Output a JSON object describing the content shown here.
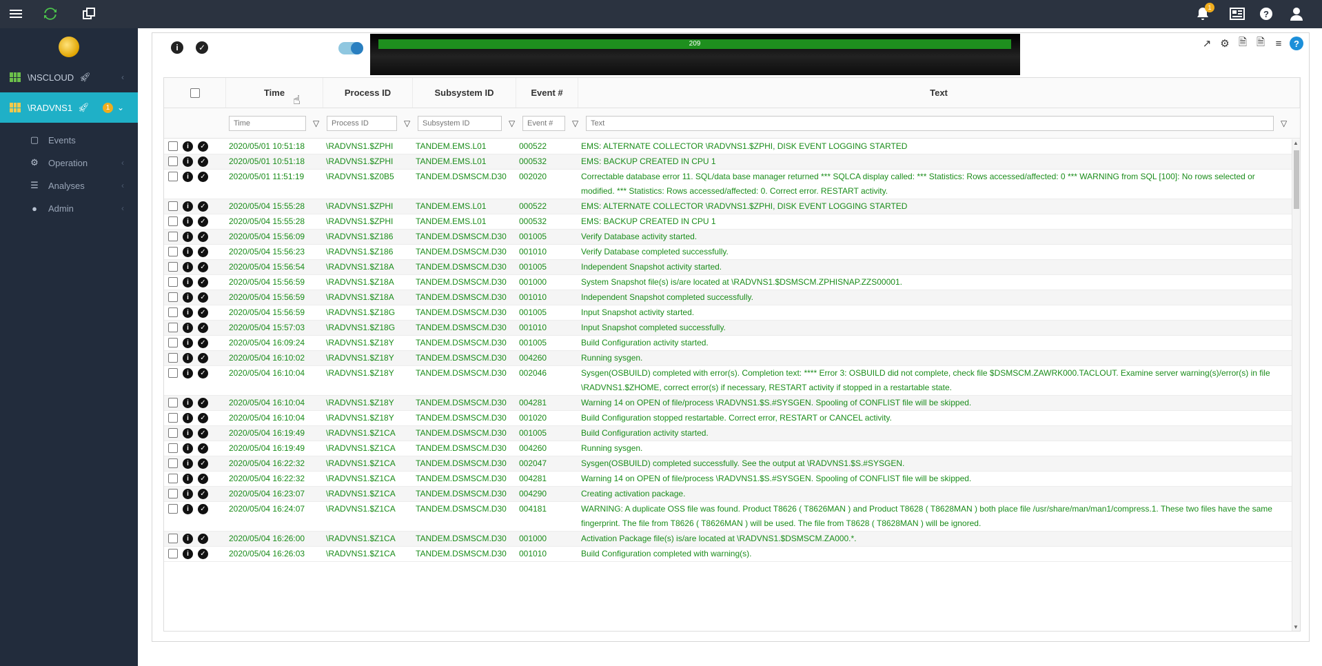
{
  "topbar": {
    "icons": [
      "menu-icon",
      "refresh-icon",
      "copy-window-icon",
      "bell-icon",
      "newspaper-icon",
      "help-icon",
      "user-icon"
    ],
    "notification_count": "1"
  },
  "sidebar": {
    "nodes": [
      {
        "label": "\\NSCLOUD",
        "badge": ""
      },
      {
        "label": "\\RADVNS1",
        "badge": "1"
      }
    ],
    "menu": [
      {
        "label": "Events",
        "icon": "chat-icon"
      },
      {
        "label": "Operation",
        "icon": "cogs-icon"
      },
      {
        "label": "Analyses",
        "icon": "document-icon"
      },
      {
        "label": "Admin",
        "icon": "user-icon"
      }
    ]
  },
  "panel": {
    "progress_value": "209",
    "toggle_on": true
  },
  "grid": {
    "columns": [
      "Time",
      "Process ID",
      "Subsystem ID",
      "Event #",
      "Text"
    ],
    "filter_placeholders": [
      "Time",
      "Process ID",
      "Subsystem ID",
      "Event #",
      "Text"
    ],
    "rows": [
      {
        "time": "2020/05/01 10:51:18",
        "process": "\\RADVNS1.$ZPHI",
        "subsystem": "TANDEM.EMS.L01",
        "event": "000522",
        "text": "EMS: ALTERNATE COLLECTOR \\RADVNS1.$ZPHI, DISK EVENT LOGGING STARTED"
      },
      {
        "time": "2020/05/01 10:51:18",
        "process": "\\RADVNS1.$ZPHI",
        "subsystem": "TANDEM.EMS.L01",
        "event": "000532",
        "text": "EMS: BACKUP CREATED IN CPU 1"
      },
      {
        "time": "2020/05/01 11:51:19",
        "process": "\\RADVNS1.$Z0B5",
        "subsystem": "TANDEM.DSMSCM.D30",
        "event": "002020",
        "text": "Correctable database error 11. SQL/data base manager returned *** SQLCA display called: *** Statistics: Rows accessed/affected: 0 *** WARNING from SQL [100]: No rows selected or modified. *** Statistics: Rows accessed/affected: 0. Correct error. RESTART activity."
      },
      {
        "time": "2020/05/04 15:55:28",
        "process": "\\RADVNS1.$ZPHI",
        "subsystem": "TANDEM.EMS.L01",
        "event": "000522",
        "text": "EMS: ALTERNATE COLLECTOR \\RADVNS1.$ZPHI, DISK EVENT LOGGING STARTED"
      },
      {
        "time": "2020/05/04 15:55:28",
        "process": "\\RADVNS1.$ZPHI",
        "subsystem": "TANDEM.EMS.L01",
        "event": "000532",
        "text": "EMS: BACKUP CREATED IN CPU 1"
      },
      {
        "time": "2020/05/04 15:56:09",
        "process": "\\RADVNS1.$Z186",
        "subsystem": "TANDEM.DSMSCM.D30",
        "event": "001005",
        "text": "Verify Database activity started."
      },
      {
        "time": "2020/05/04 15:56:23",
        "process": "\\RADVNS1.$Z186",
        "subsystem": "TANDEM.DSMSCM.D30",
        "event": "001010",
        "text": "Verify Database completed successfully."
      },
      {
        "time": "2020/05/04 15:56:54",
        "process": "\\RADVNS1.$Z18A",
        "subsystem": "TANDEM.DSMSCM.D30",
        "event": "001005",
        "text": "Independent Snapshot activity started."
      },
      {
        "time": "2020/05/04 15:56:59",
        "process": "\\RADVNS1.$Z18A",
        "subsystem": "TANDEM.DSMSCM.D30",
        "event": "001000",
        "text": "System Snapshot file(s) is/are located at \\RADVNS1.$DSMSCM.ZPHISNAP.ZZS00001."
      },
      {
        "time": "2020/05/04 15:56:59",
        "process": "\\RADVNS1.$Z18A",
        "subsystem": "TANDEM.DSMSCM.D30",
        "event": "001010",
        "text": "Independent Snapshot completed successfully."
      },
      {
        "time": "2020/05/04 15:56:59",
        "process": "\\RADVNS1.$Z18G",
        "subsystem": "TANDEM.DSMSCM.D30",
        "event": "001005",
        "text": "Input Snapshot activity started."
      },
      {
        "time": "2020/05/04 15:57:03",
        "process": "\\RADVNS1.$Z18G",
        "subsystem": "TANDEM.DSMSCM.D30",
        "event": "001010",
        "text": "Input Snapshot completed successfully."
      },
      {
        "time": "2020/05/04 16:09:24",
        "process": "\\RADVNS1.$Z18Y",
        "subsystem": "TANDEM.DSMSCM.D30",
        "event": "001005",
        "text": "Build Configuration activity started."
      },
      {
        "time": "2020/05/04 16:10:02",
        "process": "\\RADVNS1.$Z18Y",
        "subsystem": "TANDEM.DSMSCM.D30",
        "event": "004260",
        "text": "Running sysgen."
      },
      {
        "time": "2020/05/04 16:10:04",
        "process": "\\RADVNS1.$Z18Y",
        "subsystem": "TANDEM.DSMSCM.D30",
        "event": "002046",
        "text": "Sysgen(OSBUILD) completed with error(s). Completion text: **** Error 3: OSBUILD did not complete, check file $DSMSCM.ZAWRK000.TACLOUT. Examine server warning(s)/error(s) in file \\RADVNS1.$ZHOME, correct error(s) if necessary, RESTART activity if stopped in a restartable state."
      },
      {
        "time": "2020/05/04 16:10:04",
        "process": "\\RADVNS1.$Z18Y",
        "subsystem": "TANDEM.DSMSCM.D30",
        "event": "004281",
        "text": "Warning 14 on OPEN of file/process \\RADVNS1.$S.#SYSGEN. Spooling of CONFLIST file will be skipped."
      },
      {
        "time": "2020/05/04 16:10:04",
        "process": "\\RADVNS1.$Z18Y",
        "subsystem": "TANDEM.DSMSCM.D30",
        "event": "001020",
        "text": "Build Configuration stopped restartable. Correct error, RESTART or CANCEL activity."
      },
      {
        "time": "2020/05/04 16:19:49",
        "process": "\\RADVNS1.$Z1CA",
        "subsystem": "TANDEM.DSMSCM.D30",
        "event": "001005",
        "text": "Build Configuration activity started."
      },
      {
        "time": "2020/05/04 16:19:49",
        "process": "\\RADVNS1.$Z1CA",
        "subsystem": "TANDEM.DSMSCM.D30",
        "event": "004260",
        "text": "Running sysgen."
      },
      {
        "time": "2020/05/04 16:22:32",
        "process": "\\RADVNS1.$Z1CA",
        "subsystem": "TANDEM.DSMSCM.D30",
        "event": "002047",
        "text": "Sysgen(OSBUILD) completed successfully. See the output at \\RADVNS1.$S.#SYSGEN."
      },
      {
        "time": "2020/05/04 16:22:32",
        "process": "\\RADVNS1.$Z1CA",
        "subsystem": "TANDEM.DSMSCM.D30",
        "event": "004281",
        "text": "Warning 14 on OPEN of file/process \\RADVNS1.$S.#SYSGEN. Spooling of CONFLIST file will be skipped."
      },
      {
        "time": "2020/05/04 16:23:07",
        "process": "\\RADVNS1.$Z1CA",
        "subsystem": "TANDEM.DSMSCM.D30",
        "event": "004290",
        "text": "Creating activation package."
      },
      {
        "time": "2020/05/04 16:24:07",
        "process": "\\RADVNS1.$Z1CA",
        "subsystem": "TANDEM.DSMSCM.D30",
        "event": "004181",
        "text": "WARNING: A duplicate OSS file was found. Product T8626 ( T8626MAN ) and Product T8628 ( T8628MAN ) both place file /usr/share/man/man1/compress.1. These two files have the same fingerprint. The file from T8626 ( T8626MAN ) will be used. The file from T8628 ( T8628MAN ) will be ignored."
      },
      {
        "time": "2020/05/04 16:26:00",
        "process": "\\RADVNS1.$Z1CA",
        "subsystem": "TANDEM.DSMSCM.D30",
        "event": "001000",
        "text": "Activation Package file(s) is/are located at \\RADVNS1.$DSMSCM.ZA000.*."
      },
      {
        "time": "2020/05/04 16:26:03",
        "process": "\\RADVNS1.$Z1CA",
        "subsystem": "TANDEM.DSMSCM.D30",
        "event": "001010",
        "text": "Build Configuration completed with warning(s)."
      }
    ]
  }
}
